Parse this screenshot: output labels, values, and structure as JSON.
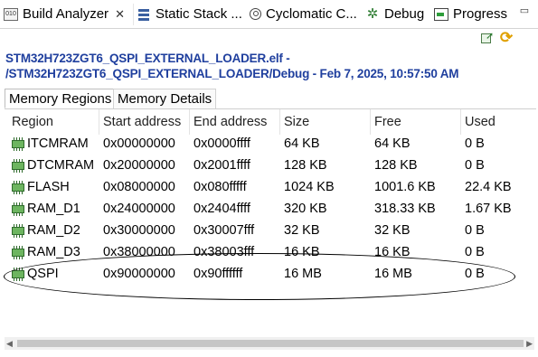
{
  "view_tabs": [
    {
      "label": "Build Analyzer",
      "icon": "analyzer-icon",
      "active": true,
      "close": "✕"
    },
    {
      "label": "Static Stack ...",
      "icon": "stack-icon"
    },
    {
      "label": "Cyclomatic C...",
      "icon": "cyclomatic-icon"
    },
    {
      "label": "Debug",
      "icon": "debug-icon"
    },
    {
      "label": "Progress",
      "icon": "progress-icon"
    }
  ],
  "toolbar": {
    "export_icon": "export-icon",
    "refresh_icon": "refresh-icon"
  },
  "file_header": {
    "line1": "STM32H723ZGT6_QSPI_EXTERNAL_LOADER.elf -",
    "line2": "/STM32H723ZGT6_QSPI_EXTERNAL_LOADER/Debug - Feb 7, 2025, 10:57:50 AM"
  },
  "inner_tabs": [
    {
      "label": "Memory Regions",
      "active": true
    },
    {
      "label": "Memory Details",
      "active": false
    }
  ],
  "table": {
    "columns": [
      "Region",
      "Start address",
      "End address",
      "Size",
      "Free",
      "Used"
    ],
    "rows": [
      [
        "ITCMRAM",
        "0x00000000",
        "0x0000ffff",
        "64 KB",
        "64 KB",
        "0 B"
      ],
      [
        "DTCMRAM",
        "0x20000000",
        "0x2001ffff",
        "128 KB",
        "128 KB",
        "0 B"
      ],
      [
        "FLASH",
        "0x08000000",
        "0x080fffff",
        "1024 KB",
        "1001.6 KB",
        "22.4 KB"
      ],
      [
        "RAM_D1",
        "0x24000000",
        "0x2404ffff",
        "320 KB",
        "318.33 KB",
        "1.67 KB"
      ],
      [
        "RAM_D2",
        "0x30000000",
        "0x30007fff",
        "32 KB",
        "32 KB",
        "0 B"
      ],
      [
        "RAM_D3",
        "0x38000000",
        "0x38003fff",
        "16 KB",
        "16 KB",
        "0 B"
      ],
      [
        "QSPI",
        "0x90000000",
        "0x90ffffff",
        "16 MB",
        "16 MB",
        "0 B"
      ]
    ]
  },
  "colors": {
    "header_link": "#1f3f9e",
    "chip_green": "#6db560"
  }
}
